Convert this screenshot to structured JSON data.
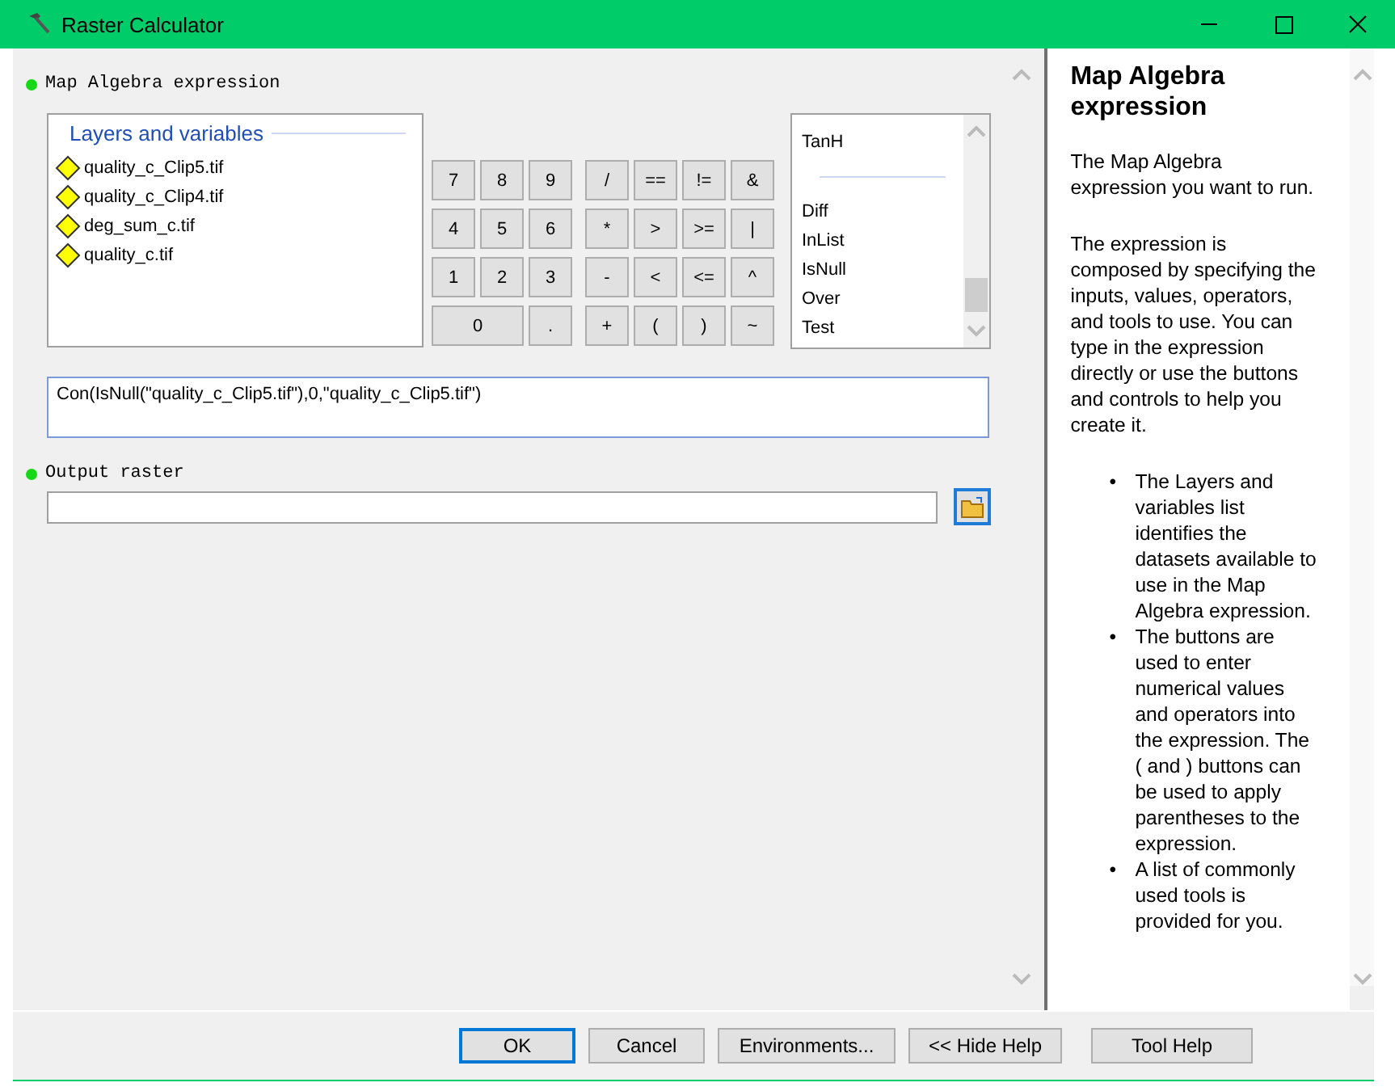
{
  "window": {
    "title": "Raster Calculator"
  },
  "expression": {
    "label": "Map Algebra expression",
    "required": true,
    "layers": {
      "title": "Layers and variables",
      "items": [
        {
          "label": "quality_c_Clip5.tif"
        },
        {
          "label": "quality_c_Clip4.tif"
        },
        {
          "label": "deg_sum_c.tif"
        },
        {
          "label": "quality_c.tif"
        }
      ]
    },
    "digit_keys": [
      {
        "label": "7",
        "wide": false
      },
      {
        "label": "8",
        "wide": false
      },
      {
        "label": "9",
        "wide": false
      },
      {
        "label": "4",
        "wide": false
      },
      {
        "label": "5",
        "wide": false
      },
      {
        "label": "6",
        "wide": false
      },
      {
        "label": "1",
        "wide": false
      },
      {
        "label": "2",
        "wide": false
      },
      {
        "label": "3",
        "wide": false
      },
      {
        "label": "0",
        "wide": true
      },
      {
        "label": ".",
        "wide": false
      }
    ],
    "operator_keys": [
      "/",
      "==",
      "!=",
      "&",
      "*",
      ">",
      ">=",
      "|",
      "-",
      "<",
      "<=",
      "^",
      "+",
      "(",
      ")",
      "~"
    ],
    "tools": [
      {
        "kind": "item",
        "label": "TanH"
      },
      {
        "kind": "separator"
      },
      {
        "kind": "item",
        "label": "Diff"
      },
      {
        "kind": "item",
        "label": "InList"
      },
      {
        "kind": "item",
        "label": "IsNull"
      },
      {
        "kind": "item",
        "label": "Over"
      },
      {
        "kind": "item",
        "label": "Test"
      }
    ],
    "value": "Con(IsNull(\"quality_c_Clip5.tif\"),0,\"quality_c_Clip5.tif\")"
  },
  "output": {
    "label": "Output raster",
    "required": true
  },
  "help": {
    "heading": "Map Algebra expression",
    "paragraphs": [
      "The Map Algebra expression you want to run.",
      "The expression is composed by specifying the inputs, values, operators, and tools to use. You can type in the expression directly or use the buttons and controls to help you create it."
    ],
    "bullets": [
      {
        "marker": "•",
        "text": "The Layers and variables list identifies the datasets available to use in the Map Algebra expression."
      },
      {
        "marker": "•",
        "text": "The buttons are used to enter numerical values and operators into the expression. The ( and ) buttons can be used to apply parentheses to the expression."
      },
      {
        "marker": "•",
        "text": "A list of commonly used tools is provided for you."
      }
    ]
  },
  "buttons": [
    {
      "label": "OK",
      "default": true
    },
    {
      "label": "Cancel",
      "default": false
    },
    {
      "label": "Environments...",
      "default": false
    },
    {
      "label": "<< Hide Help",
      "default": false
    },
    {
      "label": "Tool Help",
      "default": false
    }
  ]
}
